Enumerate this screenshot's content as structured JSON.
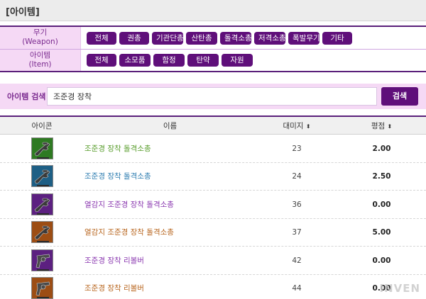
{
  "title": "[아이템]",
  "filters": [
    {
      "label": "무기",
      "label_en": "(Weapon)",
      "buttons": [
        "전체",
        "권총",
        "기관단총",
        "산탄총",
        "돌격소총",
        "저격소총",
        "폭발무기",
        "기타"
      ]
    },
    {
      "label": "아이템",
      "label_en": "(Item)",
      "buttons": [
        "전체",
        "소모품",
        "함정",
        "탄약",
        "자원"
      ]
    }
  ],
  "search": {
    "label": "아이템 검색",
    "value": "조준경 장착",
    "button": "검색"
  },
  "table": {
    "headers": {
      "icon": "아이콘",
      "name": "이름",
      "damage": "대미지",
      "rating": "평점",
      "sort_glyph": "⬍"
    },
    "rows": [
      {
        "name": "조준경 장착 돌격소총",
        "damage": "23",
        "rating": "2.00",
        "color": "#5a9e2e",
        "icon_bg": "#2e7a22",
        "icon": "rifle-icon"
      },
      {
        "name": "조준경 장착 돌격소총",
        "damage": "24",
        "rating": "2.50",
        "color": "#2e7db0",
        "icon_bg": "#1e5f85",
        "icon": "rifle-icon"
      },
      {
        "name": "열감지 조준경 장착 돌격소총",
        "damage": "36",
        "rating": "0.00",
        "color": "#8b39b0",
        "icon_bg": "#5c2080",
        "icon": "rifle-icon"
      },
      {
        "name": "열감지 조준경 장착 돌격소총",
        "damage": "37",
        "rating": "5.00",
        "color": "#b8661f",
        "icon_bg": "#9c4d14",
        "icon": "rifle-icon"
      },
      {
        "name": "조준경 장착 리볼버",
        "damage": "42",
        "rating": "0.00",
        "color": "#8b39b0",
        "icon_bg": "#5c2080",
        "icon": "revolver-icon"
      },
      {
        "name": "조준경 장착 리볼버",
        "damage": "44",
        "rating": "0.00",
        "color": "#b8661f",
        "icon_bg": "#9c4d14",
        "icon": "revolver-icon"
      }
    ]
  },
  "watermark": "INVEN"
}
